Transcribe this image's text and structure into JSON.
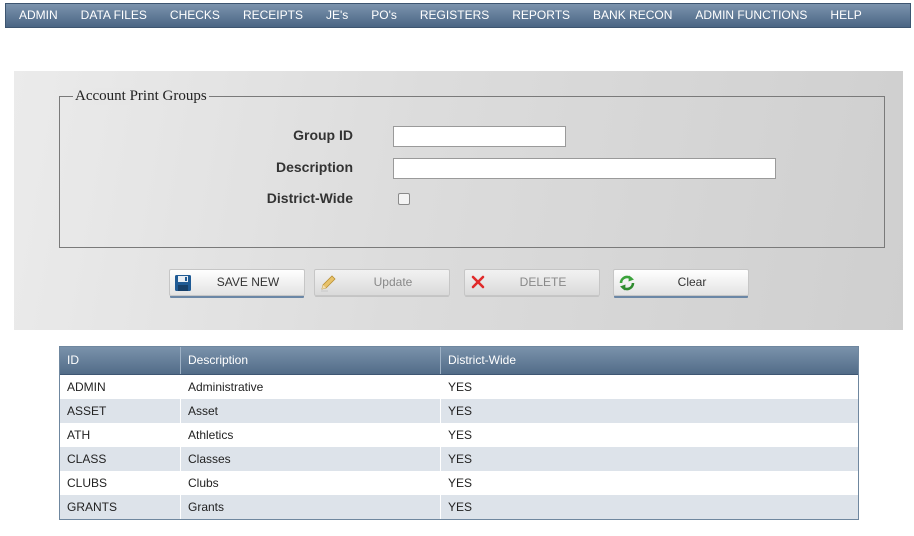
{
  "menu": [
    {
      "label": "ADMIN"
    },
    {
      "label": "DATA FILES"
    },
    {
      "label": "CHECKS"
    },
    {
      "label": "RECEIPTS"
    },
    {
      "label": "JE's"
    },
    {
      "label": "PO's"
    },
    {
      "label": "REGISTERS"
    },
    {
      "label": "REPORTS"
    },
    {
      "label": "BANK RECON"
    },
    {
      "label": "ADMIN FUNCTIONS"
    },
    {
      "label": "HELP"
    }
  ],
  "form": {
    "legend": "Account Print Groups",
    "group_id_label": "Group ID",
    "group_id_value": "",
    "description_label": "Description",
    "description_value": "",
    "district_wide_label": "District-Wide",
    "district_wide_checked": false
  },
  "buttons": {
    "save_new": {
      "label": "SAVE NEW",
      "icon": "save-disk-icon",
      "enabled": true
    },
    "update": {
      "label": "Update",
      "icon": "pencil-icon",
      "enabled": false
    },
    "delete": {
      "label": "DELETE",
      "icon": "red-x-icon",
      "enabled": false
    },
    "clear": {
      "label": "Clear",
      "icon": "refresh-icon",
      "enabled": true
    }
  },
  "table": {
    "columns": [
      "ID",
      "Description",
      "District-Wide"
    ],
    "rows": [
      [
        "ADMIN",
        "Administrative",
        "YES"
      ],
      [
        "ASSET",
        "Asset",
        "YES"
      ],
      [
        "ATH",
        "Athletics",
        "YES"
      ],
      [
        "CLASS",
        "Classes",
        "YES"
      ],
      [
        "CLUBS",
        "Clubs",
        "YES"
      ],
      [
        "GRANTS",
        "Grants",
        "YES"
      ]
    ]
  },
  "colors": {
    "menu_bar": "#5f7894",
    "table_header": "#647e9b",
    "row_alt": "#dde3ea",
    "button_accent": "#6b87a6"
  }
}
